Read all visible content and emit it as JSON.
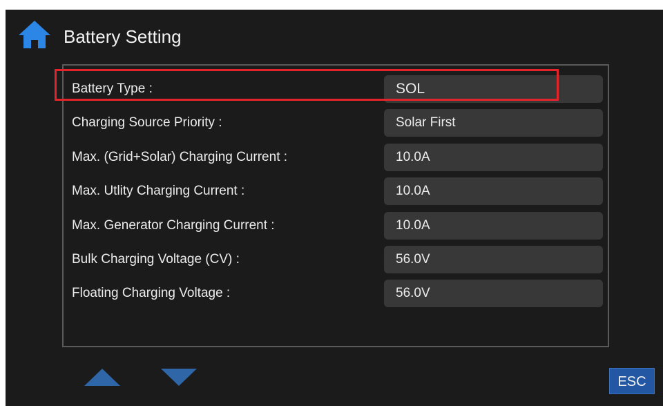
{
  "header": {
    "title": "Battery Setting",
    "home_icon": "home-icon"
  },
  "settings": [
    {
      "label": "Battery Type :",
      "value": "SOL"
    },
    {
      "label": "Charging Source Priority :",
      "value": "Solar First"
    },
    {
      "label": "Max. (Grid+Solar) Charging Current :",
      "value": "10.0A"
    },
    {
      "label": "Max. Utlity Charging Current :",
      "value": "10.0A"
    },
    {
      "label": "Max. Generator Charging Current :",
      "value": "10.0A"
    },
    {
      "label": "Bulk Charging Voltage (CV) :",
      "value": "56.0V"
    },
    {
      "label": "Floating Charging Voltage :",
      "value": "56.0V"
    }
  ],
  "navigation": {
    "up_icon": "arrow-up-icon",
    "down_icon": "arrow-down-icon",
    "esc_label": "ESC"
  },
  "colors": {
    "background": "#1b1b1b",
    "value_box": "#383838",
    "accent_blue": "#2f66a8",
    "highlight_red": "#e3252b"
  }
}
